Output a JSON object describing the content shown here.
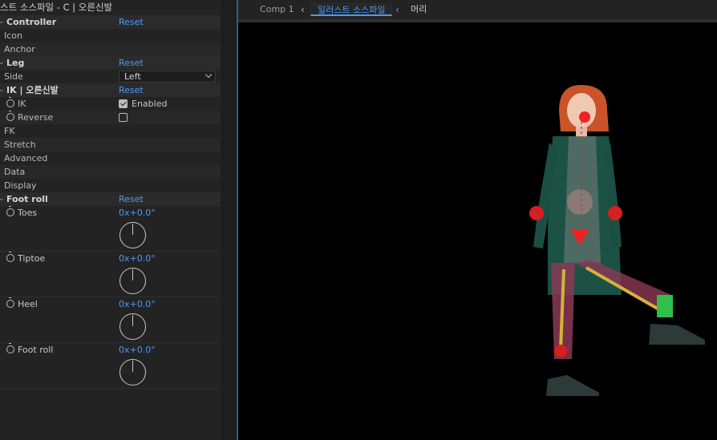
{
  "panel": {
    "title": "스트 소스파일 - C | 오른신발",
    "rows": {
      "controller": {
        "label": "Controller",
        "value": "Reset"
      },
      "icon": {
        "label": "Icon"
      },
      "anchor": {
        "label": "Anchor"
      },
      "leg": {
        "label": "Leg",
        "value": "Reset"
      },
      "side": {
        "label": "Side",
        "value": "Left"
      },
      "ik_group": {
        "label": "IK | 오른신발",
        "value": "Reset"
      },
      "ik": {
        "label": "IK",
        "value": "Enabled",
        "checked": true
      },
      "reverse": {
        "label": "Reverse",
        "checked": false
      },
      "fk": {
        "label": "FK"
      },
      "stretch": {
        "label": "Stretch"
      },
      "advanced": {
        "label": "Advanced"
      },
      "data": {
        "label": "Data"
      },
      "display": {
        "label": "Display"
      },
      "foot_roll_group": {
        "label": "Foot roll",
        "value": "Reset"
      },
      "toes": {
        "label": "Toes",
        "value": "0x+0.0°"
      },
      "tiptoe": {
        "label": "Tiptoe",
        "value": "0x+0.0°"
      },
      "heel": {
        "label": "Heel",
        "value": "0x+0.0°"
      },
      "foot_roll": {
        "label": "Foot roll",
        "value": "0x+0.0°"
      }
    }
  },
  "tabs": {
    "comp1": "Comp 1",
    "active": "일러스트 소스파일",
    "head": "머리"
  },
  "colors": {
    "accent": "#4a9bf5",
    "viewer_bg": "#000000"
  },
  "icons": {
    "stopwatch": "stopwatch-icon",
    "chevron_left": "chevron-left-icon",
    "dropdown": "chevron-down-icon"
  }
}
